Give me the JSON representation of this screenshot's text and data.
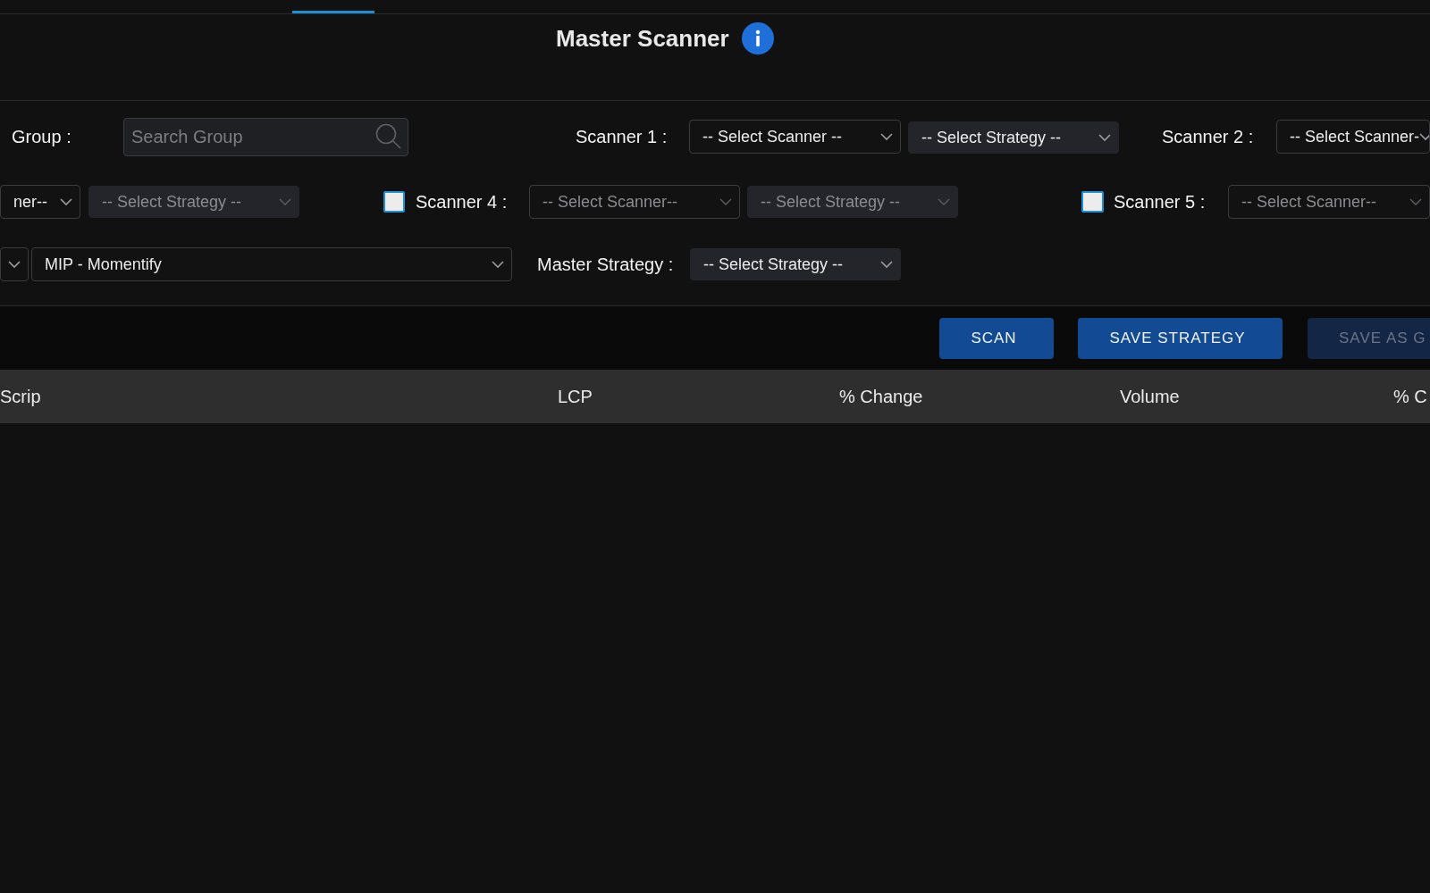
{
  "title": "Master Scanner",
  "filter_rows": [
    {
      "items": [
        {
          "kind": "label",
          "text": "Group :"
        },
        {
          "kind": "search",
          "placeholder": "Search Group"
        },
        {
          "kind": "label",
          "text": "Scanner 1 :"
        },
        {
          "kind": "select",
          "value": "-- Select Scanner --",
          "disabled": false
        },
        {
          "kind": "strategy",
          "value": "-- Select Strategy --",
          "disabled": false
        },
        {
          "kind": "label",
          "text": "Scanner 2 :"
        },
        {
          "kind": "select",
          "value": "-- Select Scanner-",
          "disabled": false
        }
      ]
    },
    {
      "items": [
        {
          "kind": "select",
          "value": "ner--",
          "disabled": false
        },
        {
          "kind": "strategy",
          "value": "-- Select Strategy --",
          "disabled": true
        },
        {
          "kind": "checkbox",
          "checked": false
        },
        {
          "kind": "label",
          "text": "Scanner 4 :"
        },
        {
          "kind": "select",
          "value": "-- Select Scanner--",
          "disabled": true
        },
        {
          "kind": "strategy",
          "value": "-- Select Strategy --",
          "disabled": true
        },
        {
          "kind": "checkbox",
          "checked": false
        },
        {
          "kind": "label",
          "text": "Scanner 5 :"
        },
        {
          "kind": "select",
          "value": "-- Select Scanner--",
          "disabled": true
        }
      ]
    },
    {
      "items": [
        {
          "kind": "select",
          "disabled": false
        },
        {
          "kind": "select",
          "value": "MIP - Momentify",
          "disabled": false
        },
        {
          "kind": "label",
          "text": "Master Strategy :"
        },
        {
          "kind": "strategy",
          "value": "-- Select Strategy --",
          "disabled": false
        }
      ]
    }
  ],
  "buttons": [
    {
      "label": "SCAN",
      "disabled": false
    },
    {
      "label": "SAVE STRATEGY",
      "disabled": false
    },
    {
      "label": "SAVE AS G",
      "disabled": true
    }
  ],
  "table": {
    "columns": [
      "Scrip",
      "LCP",
      "% Change",
      "Volume",
      "% C"
    ]
  }
}
